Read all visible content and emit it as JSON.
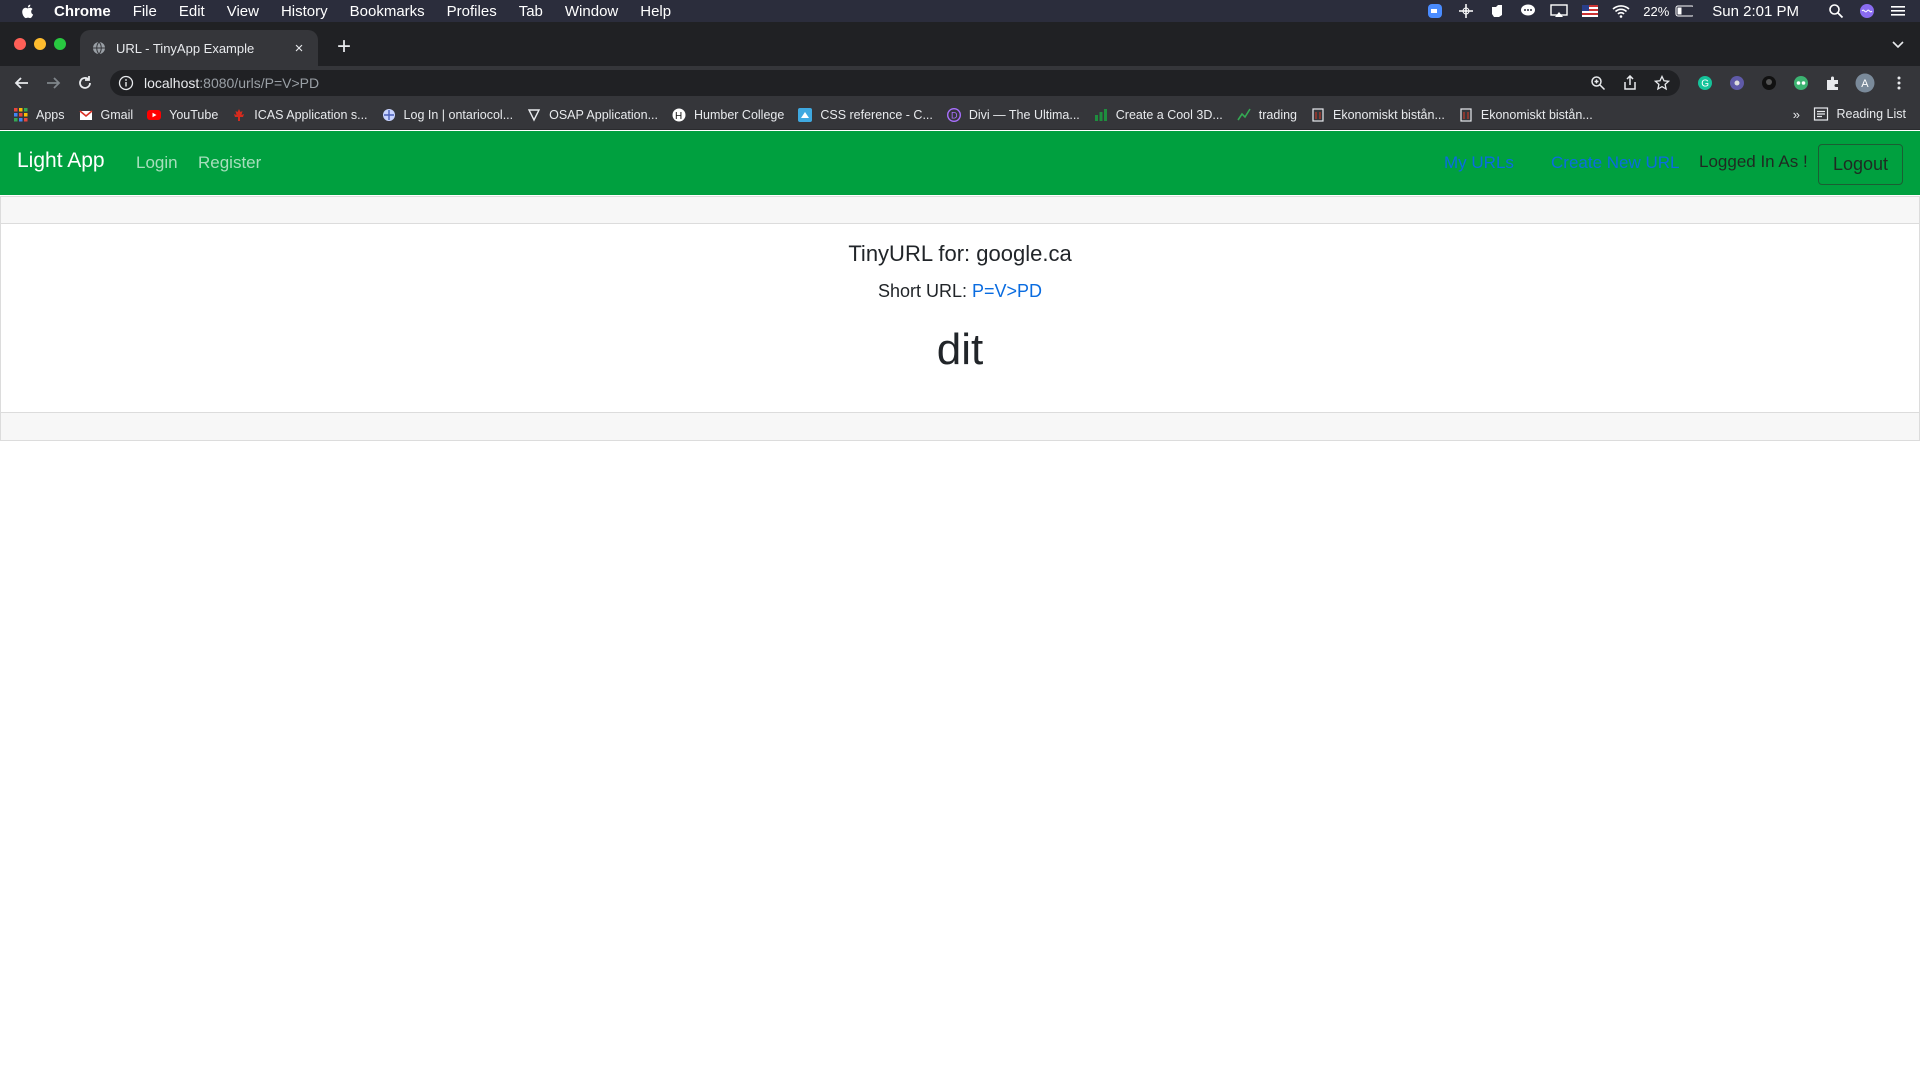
{
  "menubar": {
    "app": "Chrome",
    "items": [
      "File",
      "Edit",
      "View",
      "History",
      "Bookmarks",
      "Profiles",
      "Tab",
      "Window",
      "Help"
    ],
    "battery": "22%",
    "clock": "Sun 2:01 PM"
  },
  "tab": {
    "title": "URL - TinyApp Example",
    "close": "×",
    "new": "+"
  },
  "omnibox": {
    "host": "localhost",
    "path": ":8080/urls/P=V>PD"
  },
  "bookmarks": {
    "items": [
      "Apps",
      "Gmail",
      "YouTube",
      "ICAS Application s...",
      "Log In | ontariocol...",
      "OSAP Application...",
      "Humber College",
      "CSS reference - C...",
      "Divi — The Ultima...",
      "Create a Cool 3D...",
      "trading",
      "Ekonomiskt bistån...",
      "Ekonomiskt bistån..."
    ],
    "more": "»",
    "reading_list": "Reading List"
  },
  "navbar": {
    "brand": "Light App",
    "login": "Login",
    "register": "Register",
    "my_urls": "My URLs",
    "create_new": "Create New URL",
    "logged_in": "Logged In As !",
    "logout": "Logout"
  },
  "content": {
    "title": "TinyURL for: google.ca",
    "short_label": "Short URL: ",
    "short_value": "P=V>PD",
    "big_text": "dit"
  },
  "colors": {
    "navbar": "#00a03f",
    "link_blue": "#0a6ce0",
    "chrome_dark": "#202124",
    "chrome_toolbar": "#35363a",
    "menubar": "#2b2d3c"
  }
}
